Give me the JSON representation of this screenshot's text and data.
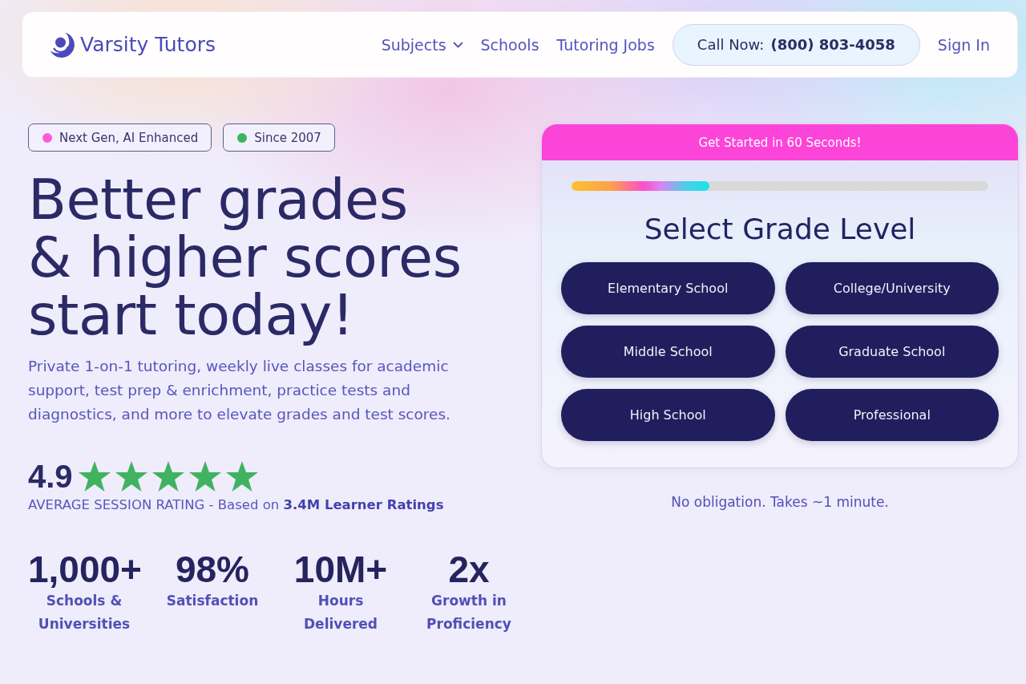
{
  "header": {
    "logo": {
      "text": "Varsity Tutors"
    },
    "nav": [
      {
        "label": "Subjects",
        "kind": "dropdown"
      },
      {
        "label": "Schools",
        "kind": "link"
      },
      {
        "label": "Tutoring Jobs",
        "kind": "link"
      }
    ],
    "call_button": {
      "label": "Call Now:",
      "phone": "(800) 803-4058"
    },
    "sign_in": "Sign In"
  },
  "hero": {
    "tags": [
      {
        "label": "Next Gen, AI Enhanced",
        "color": "#ff5ad8"
      },
      {
        "label": "Since 2007",
        "color": "#3fb35f"
      }
    ],
    "headline": "Better grades\n& higher scores\nstart today!",
    "description": "Private 1-on-1 tutoring, weekly live classes for academic support, test prep & enrichment, practice tests and diagnostics, and more to elevate grades and test scores.",
    "rating": {
      "score": "4.9",
      "stars": 5,
      "caption": "AVERAGE SESSION RATING - Based on **3.4M Learner Ratings**"
    },
    "stats": [
      {
        "value": "1,000+",
        "label": "Schools & Universities"
      },
      {
        "value": "98%",
        "label": "Satisfaction"
      },
      {
        "value": "10M+",
        "label": "Hours Delivered"
      },
      {
        "value": "2x",
        "label": "Growth in Proficiency"
      }
    ]
  },
  "form_card": {
    "banner": "Get Started in 60 Seconds!",
    "progress": {
      "level": 0.33
    },
    "title": "Select Grade Level",
    "options": [
      "Elementary School",
      "College/University",
      "Middle School",
      "Graduate School",
      "High School",
      "Professional"
    ]
  },
  "note": "No obligation. Takes ~1 minute."
}
